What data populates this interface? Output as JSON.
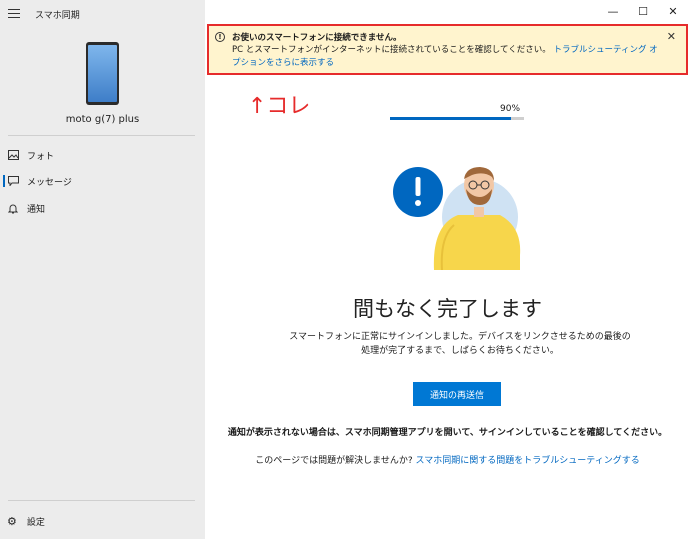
{
  "app": {
    "title": "スマホ同期"
  },
  "device": {
    "name": "moto g(7) plus"
  },
  "nav": [
    {
      "label": "フォト",
      "icon": "photo-icon"
    },
    {
      "label": "メッセージ",
      "icon": "message-icon",
      "active": true
    },
    {
      "label": "通知",
      "icon": "bell-icon"
    }
  ],
  "settings": {
    "label": "設定",
    "icon": "gear-icon"
  },
  "window": {
    "minimize": "—",
    "maximize": "☐",
    "close": "✕"
  },
  "banner": {
    "title": "お使いのスマートフォンに接続できません。",
    "message": "PC とスマートフォンがインターネットに接続されていることを確認してください。",
    "link": "トラブルシューティング オプションをさらに表示する",
    "close": "✕"
  },
  "annotation": "↑コレ",
  "progress": {
    "percent_label": "90%",
    "value": 0.9
  },
  "main": {
    "headline": "間もなく完了します",
    "description": "スマートフォンに正常にサインインしました。デバイスをリンクさせるための最後の処理が完了するまで、しばらくお待ちください。",
    "resend_button": "通知の再送信",
    "note": "通知が表示されない場合は、スマホ同期管理アプリを開いて、サインインしていることを確認してください。",
    "help_prefix": "このページでは問題が解決しませんか?",
    "help_link": "スマホ同期に関する問題をトラブルシューティングする"
  },
  "colors": {
    "accent": "#0078d4",
    "banner_bg": "#fff4ce",
    "annotation": "#e62b2b"
  }
}
